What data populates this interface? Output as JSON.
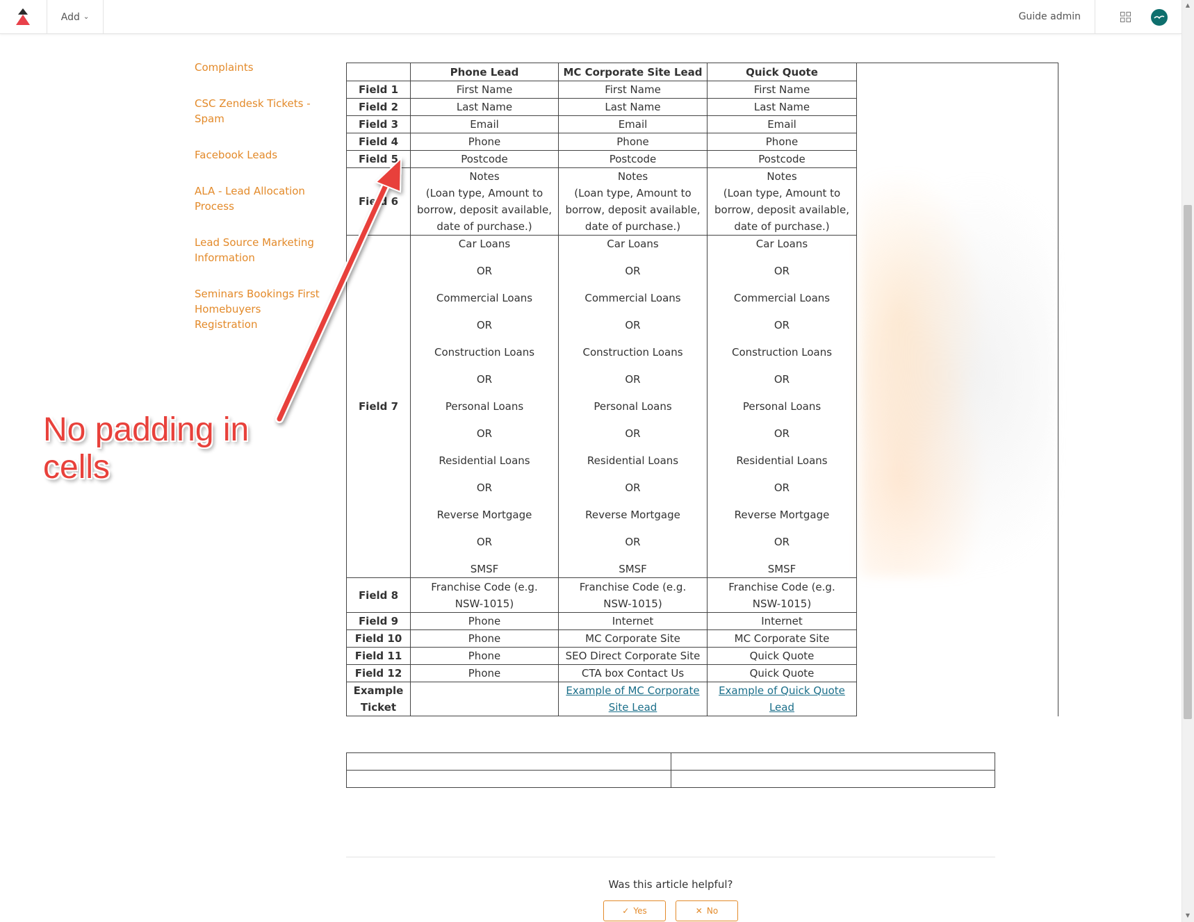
{
  "topbar": {
    "add_label": "Add",
    "user_label": "Guide admin"
  },
  "sidebar": {
    "items": [
      {
        "label": "Complaints"
      },
      {
        "label": "CSC Zendesk Tickets - Spam"
      },
      {
        "label": "Facebook Leads"
      },
      {
        "label": "ALA - Lead Allocation Process"
      },
      {
        "label": "Lead Source Marketing Information"
      },
      {
        "label": "Seminars Bookings First Homebuyers Registration"
      }
    ]
  },
  "table": {
    "headers": [
      "Phone Lead",
      "MC Corporate Site Lead",
      "Quick Quote"
    ],
    "rows": [
      {
        "label": "Field 1",
        "cells": [
          "First Name",
          "First Name",
          "First Name"
        ]
      },
      {
        "label": "Field 2",
        "cells": [
          "Last Name",
          "Last Name",
          "Last Name"
        ]
      },
      {
        "label": "Field 3",
        "cells": [
          "Email",
          "Email",
          "Email"
        ]
      },
      {
        "label": "Field 4",
        "cells": [
          "Phone",
          "Phone",
          "Phone"
        ]
      },
      {
        "label": "Field 5",
        "cells": [
          "Postcode",
          "Postcode",
          "Postcode"
        ]
      },
      {
        "label": "Field 6",
        "cells": [
          "Notes\n(Loan type, Amount to borrow, deposit available, date of purchase.)",
          "Notes\n(Loan type, Amount to borrow, deposit available, date of purchase.)",
          "Notes\n(Loan type, Amount to borrow, deposit available, date of purchase.)"
        ]
      },
      {
        "label": "Field 7",
        "options": [
          "Car Loans",
          "OR",
          "Commercial Loans",
          "OR",
          "Construction Loans",
          "OR",
          "Personal Loans",
          "OR",
          "Residential Loans",
          "OR",
          "Reverse Mortgage",
          "OR",
          "SMSF"
        ]
      },
      {
        "label": "Field 8",
        "cells": [
          "Franchise Code (e.g. NSW-1015)",
          "Franchise Code (e.g. NSW-1015)",
          "Franchise Code (e.g. NSW-1015)"
        ]
      },
      {
        "label": "Field 9",
        "cells": [
          "Phone",
          "Internet",
          "Internet"
        ]
      },
      {
        "label": "Field 10",
        "cells": [
          "Phone",
          "MC Corporate Site",
          "MC Corporate Site"
        ]
      },
      {
        "label": "Field 11",
        "cells": [
          "Phone",
          "SEO Direct Corporate Site",
          "Quick Quote"
        ]
      },
      {
        "label": "Field 12",
        "cells": [
          "Phone",
          "CTA box Contact Us",
          "Quick Quote"
        ]
      }
    ],
    "example": {
      "label": "Example Ticket",
      "link_mc": "Example of MC Corporate Site Lead",
      "link_qq": "Example of Quick Quote Lead"
    }
  },
  "feedback": {
    "question": "Was this article helpful?",
    "yes": "Yes",
    "no": "No"
  },
  "annotation": {
    "text": "No padding in cells",
    "color": "#e8413b"
  }
}
